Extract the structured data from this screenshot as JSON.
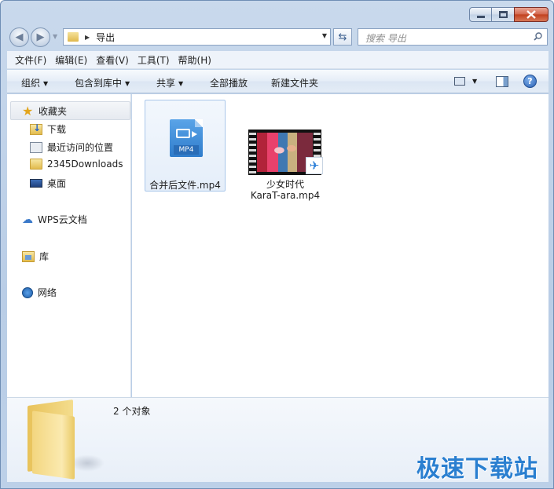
{
  "address": {
    "folder": "导出"
  },
  "search": {
    "placeholder": "搜索 导出"
  },
  "menu": [
    "文件(F)",
    "编辑(E)",
    "查看(V)",
    "工具(T)",
    "帮助(H)"
  ],
  "toolbar": {
    "organize": "组织",
    "include_in_library": "包含到库中",
    "share": "共享",
    "play_all": "全部播放",
    "new_folder": "新建文件夹"
  },
  "nav": {
    "favorites": "收藏夹",
    "fav_items": [
      "下载",
      "最近访问的位置",
      "2345Downloads",
      "桌面"
    ],
    "wps_cloud": "WPS云文档",
    "libraries": "库",
    "network": "网络"
  },
  "files": [
    {
      "name": "合并后文件.mp4",
      "icon_label": "MP4"
    },
    {
      "name_line1": "少女时代",
      "name_line2": "KaraT-ara.mp4"
    }
  ],
  "details": {
    "count": "2 个对象"
  },
  "watermark": "极速下载站"
}
